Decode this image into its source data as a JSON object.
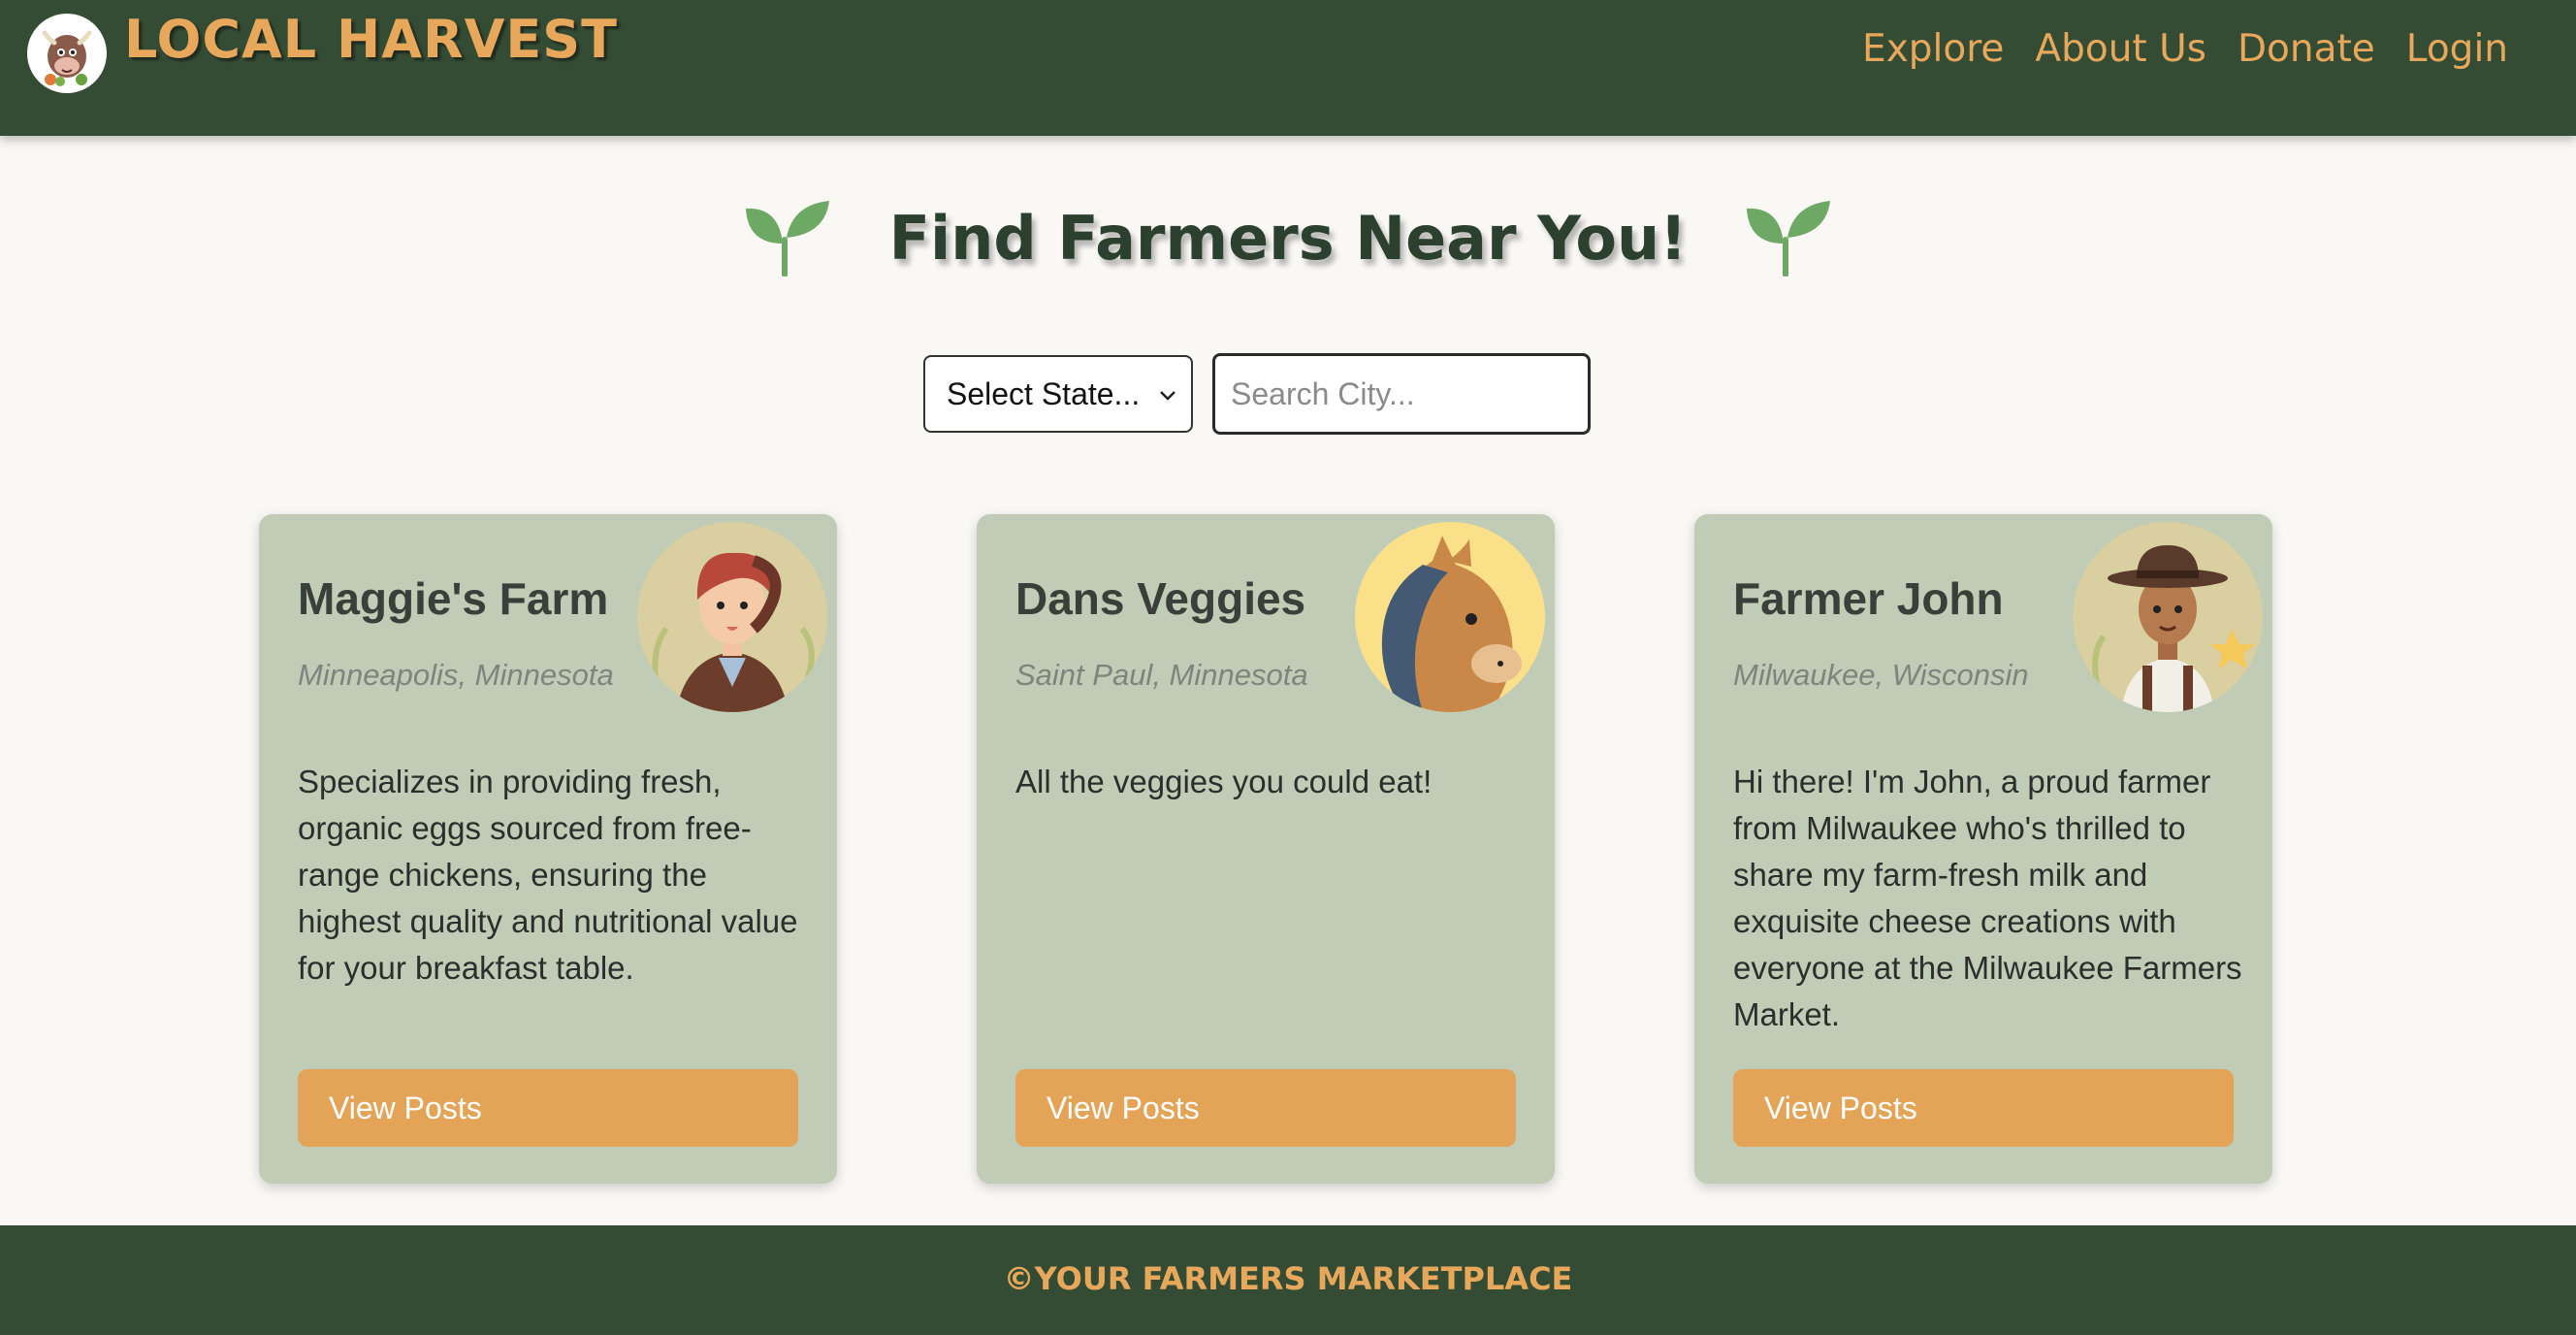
{
  "header": {
    "brand": "LOCAL HARVEST",
    "logo_icon": "cow-mascot-icon",
    "nav": [
      {
        "label": "Explore"
      },
      {
        "label": "About Us"
      },
      {
        "label": "Donate"
      },
      {
        "label": "Login"
      }
    ]
  },
  "main": {
    "title": "Find Farmers Near You!",
    "sprout_icon": "sprout-icon",
    "state_select": {
      "selected": "Select State..."
    },
    "city_search": {
      "placeholder": "Search City...",
      "value": ""
    },
    "farmers": [
      {
        "name": "Maggie's Farm",
        "location": "Minneapolis, Minnesota",
        "description": "Specializes in providing fresh, organic eggs sourced from free-range chickens, ensuring the highest quality and nutritional value for your breakfast table.",
        "button": "View Posts",
        "avatar": "farmer-woman-avatar"
      },
      {
        "name": "Dans Veggies",
        "location": "Saint Paul, Minnesota",
        "description": "All the veggies you could eat!",
        "button": "View Posts",
        "avatar": "horse-avatar"
      },
      {
        "name": "Farmer John",
        "location": "Milwaukee, Wisconsin",
        "description": "Hi there! I'm John, a proud farmer from Milwaukee who's thrilled to share my farm-fresh milk and exquisite cheese creations with everyone at the Milwaukee Farmers Market.",
        "button": "View Posts",
        "avatar": "farmer-man-avatar"
      }
    ]
  },
  "footer": {
    "text": "©YOUR FARMERS MARKETPLACE"
  },
  "colors": {
    "header_bg": "#344b34",
    "accent": "#e8a85b",
    "card_bg": "#c0ccb6",
    "button_bg": "#e4a458",
    "page_bg": "#faf8f5"
  }
}
